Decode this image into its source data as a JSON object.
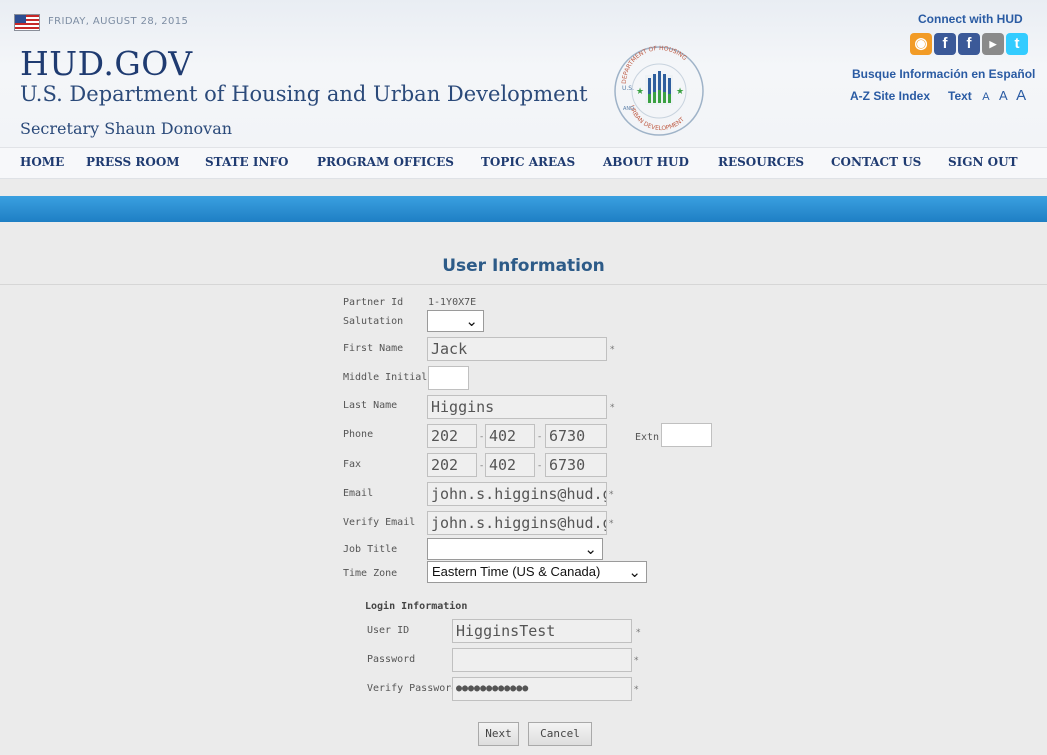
{
  "header": {
    "date": "FRIDAY, AUGUST 28, 2015",
    "site_title": "HUD.GOV",
    "department": "U.S. Department of Housing and Urban Development",
    "secretary": "Secretary Shaun Donovan",
    "seal_text_top": "DEPARTMENT OF HOUSING",
    "seal_text_left": "U.S.",
    "seal_text_bottom": "URBAN DEVELOPMENT",
    "seal_text_and": "AND",
    "connect_label": "Connect with HUD",
    "social_icons": [
      "rss-icon",
      "facebook-icon",
      "facebook-icon",
      "youtube-icon",
      "twitter-icon"
    ],
    "busque": "Busque Información en Español",
    "az_index": "A-Z Site Index",
    "text_size_label": "Text",
    "text_sizes": [
      "A",
      "A",
      "A"
    ]
  },
  "nav": [
    "HOME",
    "PRESS ROOM",
    "STATE INFO",
    "PROGRAM OFFICES",
    "TOPIC AREAS",
    "ABOUT HUD",
    "RESOURCES",
    "CONTACT US",
    "SIGN OUT"
  ],
  "page_title": "User Information",
  "form": {
    "partner_id_label": "Partner Id",
    "partner_id_value": "1-1Y0X7E",
    "salutation_label": "Salutation",
    "salutation_value": "",
    "first_name_label": "First Name",
    "first_name_value": "Jack",
    "middle_initial_label": "Middle Initial",
    "middle_initial_value": "",
    "last_name_label": "Last Name",
    "last_name_value": "Higgins",
    "phone_label": "Phone",
    "phone": [
      "202",
      "402",
      "6730"
    ],
    "extn_label": "Extn",
    "extn_value": "",
    "fax_label": "Fax",
    "fax": [
      "202",
      "402",
      "6730"
    ],
    "email_label": "Email",
    "email_value": "john.s.higgins@hud.gov",
    "verify_email_label": "Verify Email",
    "verify_email_value": "john.s.higgins@hud.gov",
    "job_title_label": "Job Title",
    "job_title_value": "",
    "time_zone_label": "Time Zone",
    "time_zone_value": "Eastern Time (US & Canada)",
    "required_marker": "*",
    "separator": "-"
  },
  "login": {
    "section_title": "Login Information",
    "user_id_label": "User ID",
    "user_id_value": "HigginsTest",
    "password_label": "Password",
    "password_value": "",
    "verify_password_label": "Verify Password",
    "verify_password_value": "●●●●●●●●●●●●"
  },
  "buttons": {
    "next": "Next",
    "cancel": "Cancel"
  },
  "colors": {
    "header_blue": "#1f3b71",
    "link_blue": "#2a5ba3",
    "band_blue": "#2a8ccf",
    "page_bg": "#ebebeb",
    "rss": "#f29b26",
    "facebook": "#3b5998",
    "youtube": "#8a8a8a",
    "twitter": "#33ccff"
  }
}
